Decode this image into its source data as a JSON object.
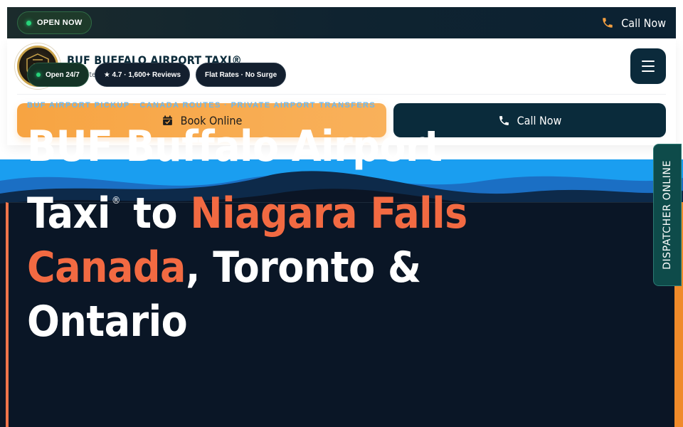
{
  "topbar": {
    "status": "OPEN NOW",
    "call_label": "Call Now"
  },
  "brand": {
    "name": "BUF BUFFALO AIRPORT TAXI®",
    "tagline": "Flat-Rate BUF Taxi to Canada",
    "logo_text": "BUF AIRPORT TAXI"
  },
  "actions": {
    "book_label": "Book Online",
    "call_label": "Call Now"
  },
  "hero": {
    "chips": [
      {
        "label": "Open 24/7"
      },
      {
        "label": "★ 4.7 · 1,600+ Reviews"
      },
      {
        "label": "Flat Rates · No Surge"
      }
    ],
    "eyebrow": "BUF AIRPORT PICKUP · CANADA ROUTES · PRIVATE AIRPORT TRANSFERS",
    "headline": {
      "line1": "BUF Buffalo Airport",
      "line2_a": "Taxi",
      "line2_reg": "®",
      "line2_b": " to ",
      "line2_accent": "Niagara Falls",
      "line3_accent": "Canada",
      "line3_rest": ", Toronto & Ontario"
    }
  },
  "dispatcher": {
    "label": "DISPATCHER ONLINE"
  },
  "colors": {
    "navy": "#0a2b3b",
    "orange": "#f7a442",
    "accent_red": "#f26a42",
    "sky": "#6ab8f0",
    "online_green": "#27d37a"
  }
}
